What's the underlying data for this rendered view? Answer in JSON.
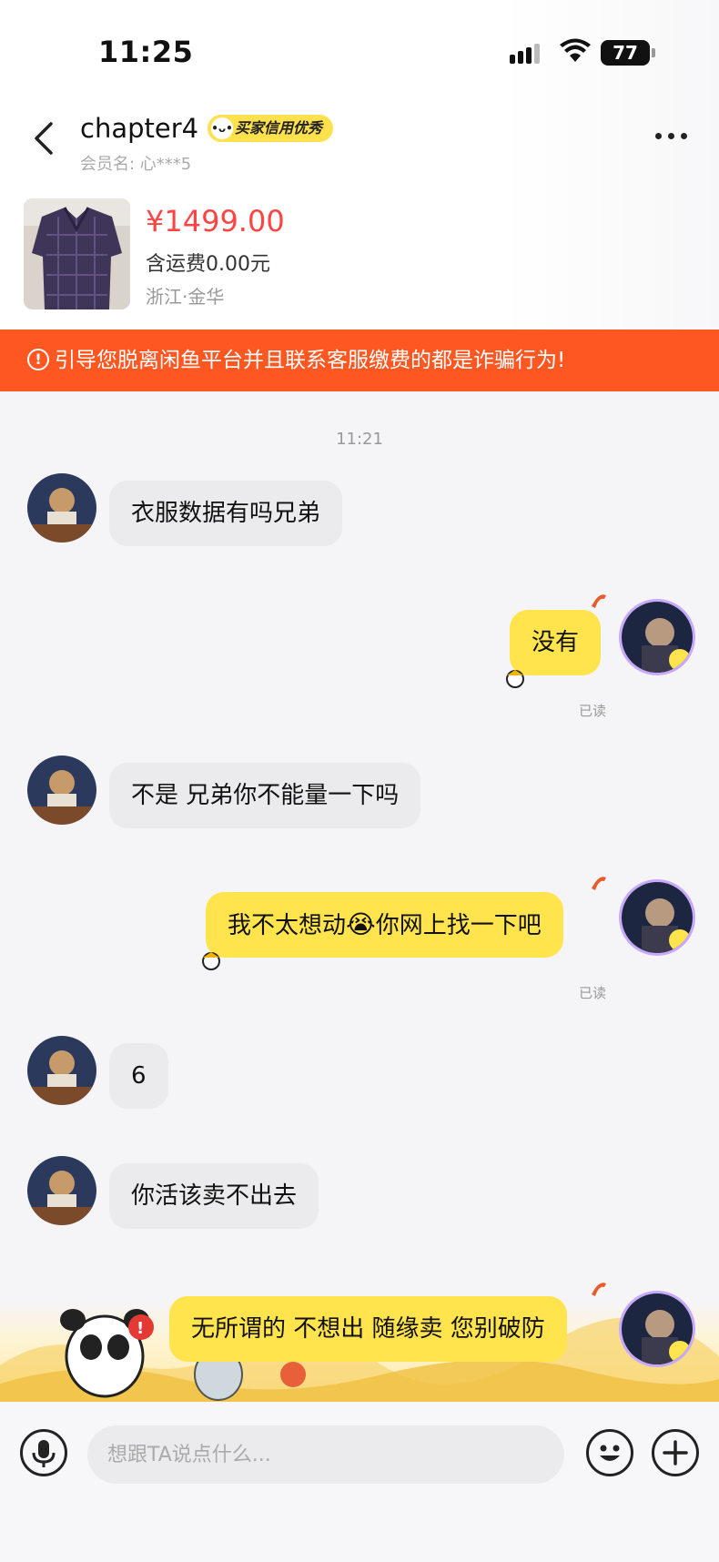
{
  "status_bar": {
    "time": "11:25",
    "battery": "77"
  },
  "header": {
    "nickname": "chapter4",
    "credit_badge": "买家信用优秀",
    "member_label": "会员名: 心***5"
  },
  "product": {
    "price": "¥1499.00",
    "shipping": "含运费0.00元",
    "location": "浙江·金华"
  },
  "warning": {
    "text": "引导您脱离闲鱼平台并且联系客服缴费的都是诈骗行为!"
  },
  "chat": {
    "timestamp": "11:21",
    "messages": [
      {
        "side": "left",
        "text": "衣服数据有吗兄弟"
      },
      {
        "side": "right",
        "text": "没有",
        "status": "已读"
      },
      {
        "side": "left",
        "text": "不是 兄弟你不能量一下吗"
      },
      {
        "side": "right",
        "text_before": "我不太想动",
        "text_after": "你网上找一下吧",
        "status": "已读"
      },
      {
        "side": "left",
        "text": "6"
      },
      {
        "side": "left",
        "text": "你活该卖不出去"
      },
      {
        "side": "right",
        "text": "无所谓的 不想出 随缘卖 您别破防"
      }
    ]
  },
  "input_bar": {
    "placeholder": "想跟TA说点什么..."
  },
  "icons": [
    "back-icon",
    "more-icon",
    "warning-icon",
    "mic-icon",
    "emoji-icon",
    "plus-icon"
  ],
  "colors": {
    "accent_yellow": "#ffe44d",
    "warning_orange": "#ff5722",
    "price_red": "#ff4444"
  }
}
